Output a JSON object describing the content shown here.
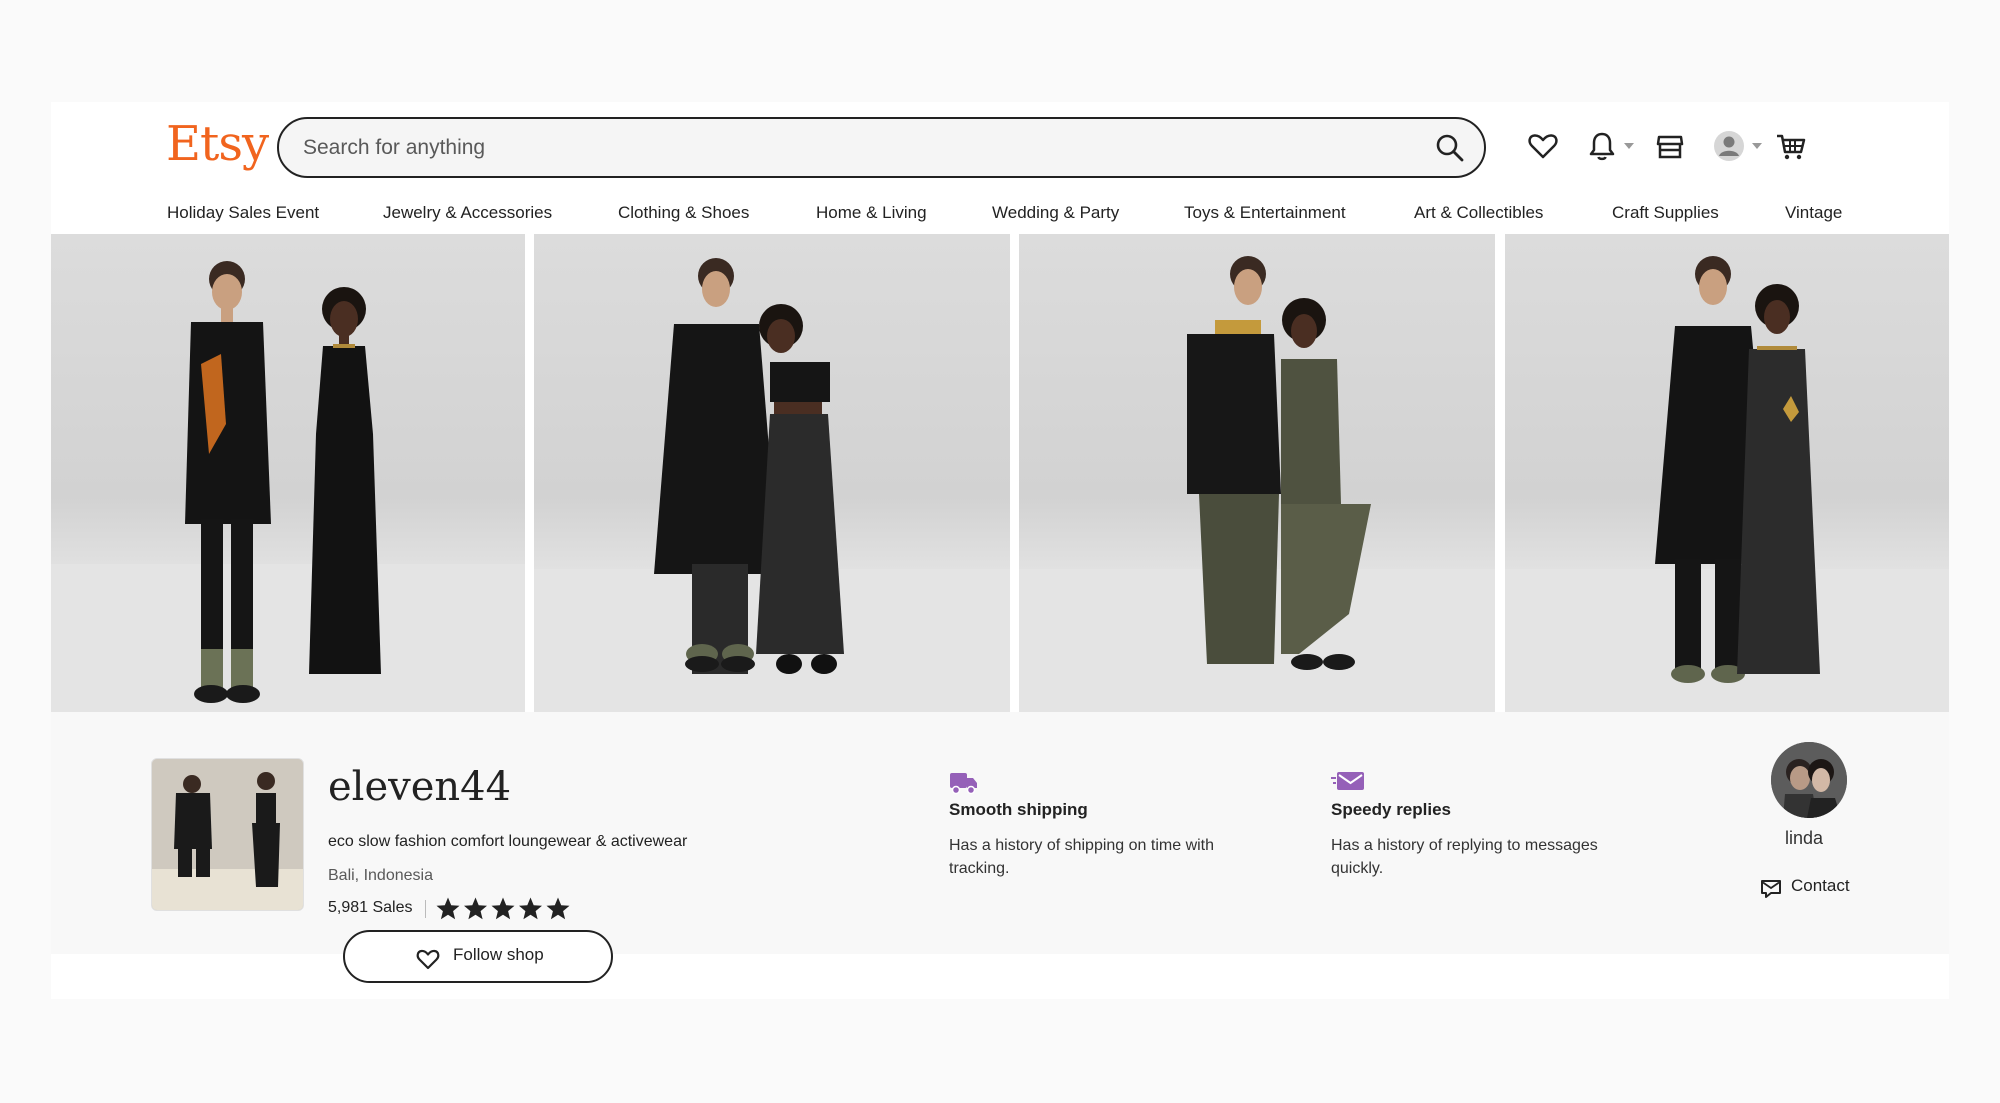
{
  "header": {
    "logo": "Etsy",
    "search_placeholder": "Search for anything"
  },
  "nav": {
    "items": [
      {
        "label": "Holiday Sales Event"
      },
      {
        "label": "Jewelry & Accessories"
      },
      {
        "label": "Clothing & Shoes"
      },
      {
        "label": "Home & Living"
      },
      {
        "label": "Wedding & Party"
      },
      {
        "label": "Toys & Entertainment"
      },
      {
        "label": "Art & Collectibles"
      },
      {
        "label": "Craft Supplies"
      },
      {
        "label": "Vintage"
      }
    ]
  },
  "shop": {
    "name": "eleven44",
    "tagline": "eco slow fashion comfort loungewear & activewear",
    "location": "Bali, Indonesia",
    "sales": "5,981 Sales",
    "rating": 5,
    "follow_label": "Follow shop"
  },
  "features": [
    {
      "title": "Smooth shipping",
      "description": "Has a history of shipping on time with tracking.",
      "icon": "truck-icon"
    },
    {
      "title": "Speedy replies",
      "description": "Has a history of replying to messages quickly.",
      "icon": "fast-message-icon"
    }
  ],
  "owner": {
    "name": "linda",
    "contact_label": "Contact"
  },
  "colors": {
    "brand": "#f1641e",
    "accent_purple": "#9560b8",
    "text": "#222222"
  }
}
